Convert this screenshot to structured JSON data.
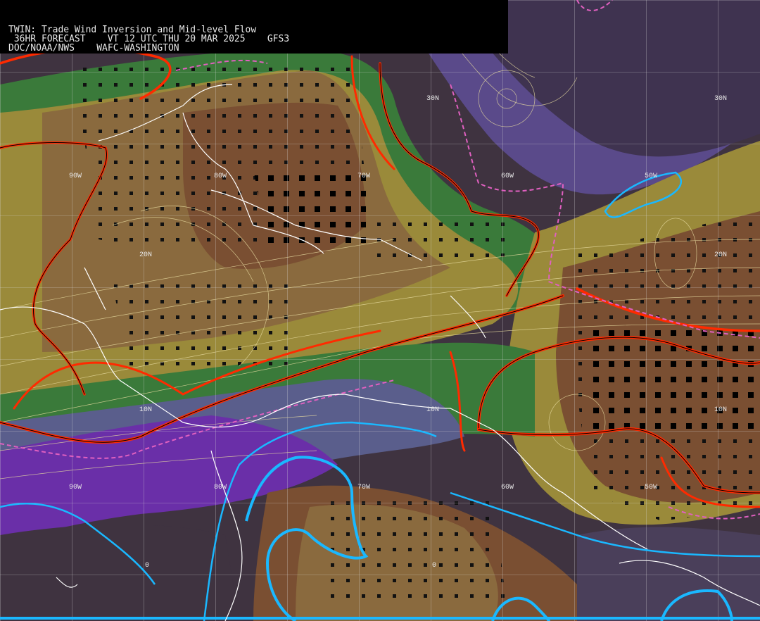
{
  "header": {
    "line1": "TWIN: Trade Wind Inversion and Mid-level Flow",
    "line2": " 36HR FORECAST    VT 12 UTC THU 20 MAR 2025    GFS3",
    "line3": "DOC/NOAA/NWS    WAFC-WASHINGTON"
  },
  "labels": {
    "lat30w": "30N",
    "lat30e": "30N",
    "lat20w": "20N",
    "lat20e": "20N",
    "lat10w": "10N",
    "lat10c": "10N",
    "lat10e": "10N",
    "lat0w": "0",
    "lat0c": "0",
    "lon90t": "90W",
    "lon80t": "80W",
    "lon70t": "70W",
    "lon60t": "60W",
    "lon50t": "50W",
    "lon90b": "90W",
    "lon80b": "80W",
    "lon70b": "70W",
    "lon60b": "60W",
    "lon50b": "50W"
  },
  "colors": {
    "background_low": "#3f3340",
    "purple": "#6a2fa8",
    "slate": "#5a5e8c",
    "green_dark": "#2f6a32",
    "green": "#4a8a3c",
    "olive": "#9a8a3a",
    "tan": "#8a6a3e",
    "brown": "#7a4f32",
    "inversion_red": "#ff2a00",
    "dashed_pink": "#e060c0",
    "freezing_cyan": "#1ab8ff",
    "streamline": "#e8dca0"
  }
}
